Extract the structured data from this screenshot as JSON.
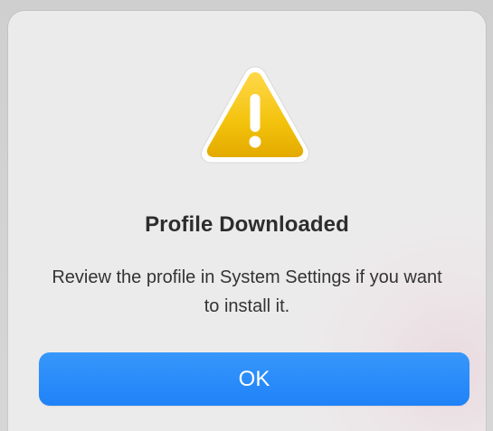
{
  "dialog": {
    "title": "Profile Downloaded",
    "message": "Review the profile in System Settings if you want to install it.",
    "icon": "warning-icon",
    "ok_label": "OK"
  },
  "colors": {
    "accent": "#1f82f8",
    "warning_yellow": "#f5c20d",
    "background": "#ecebeb"
  }
}
